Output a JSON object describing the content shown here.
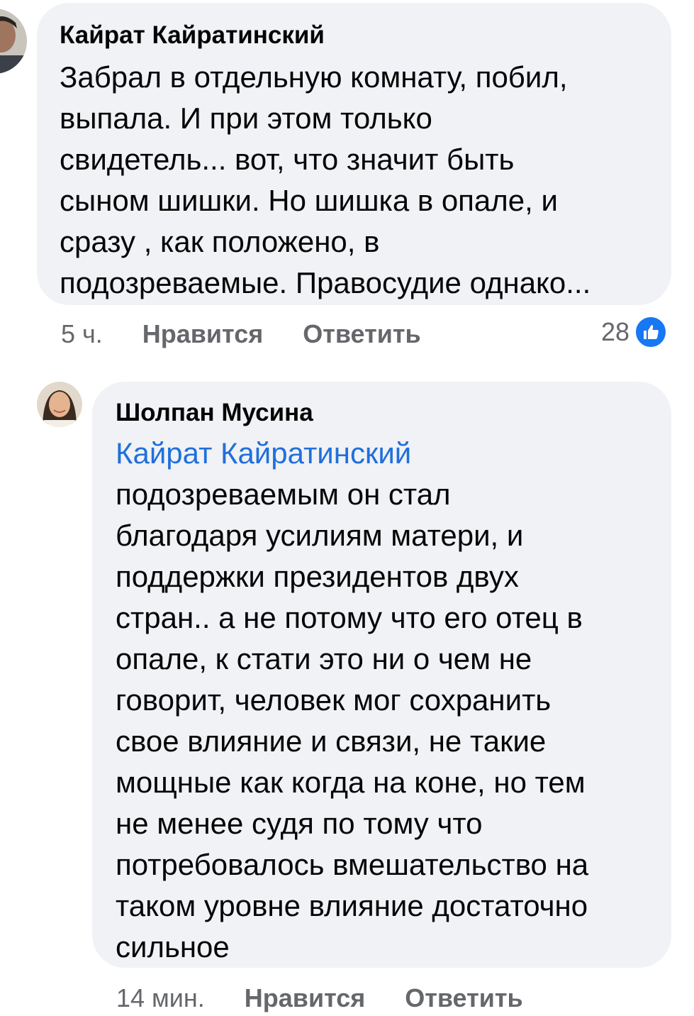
{
  "comments": [
    {
      "author": "Кайрат Кайратинский",
      "text": "Забрал в отдельную комнату, побил,\nвыпала. И при этом только\nсвидетель... вот, что значит быть\nсыном шишки. Но шишка в опале, и\nсразу , как положено, в\nподозреваемые. Правосудие однако...",
      "time": "5 ч.",
      "like_label": "Нравится",
      "reply_label": "Ответить",
      "reactions": {
        "count": "28",
        "icon": "thumbs-up-icon",
        "color": "#1877f2"
      }
    },
    {
      "author": "Шолпан Мусина",
      "mention": "Кайрат Кайратинский",
      "text": "подозреваемым он стал\nблагодаря усилиям матери,  и\nподдержки президентов двух\nстран.. а не потому что его отец в\nопале, к стати это ни о чем не\nговорит, человек мог сохранить\nсвое влияние и связи, не такие\nмощные как когда на коне, но тем\nне менее судя по тому что\nпотребовалось вмешательство на\nтаком уровне влияние достаточно\nсильное",
      "time": "14 мин.",
      "like_label": "Нравится",
      "reply_label": "Ответить"
    }
  ],
  "colors": {
    "bubble": "#f0f2f5",
    "mention": "#216fdb",
    "meta": "#65676b"
  }
}
